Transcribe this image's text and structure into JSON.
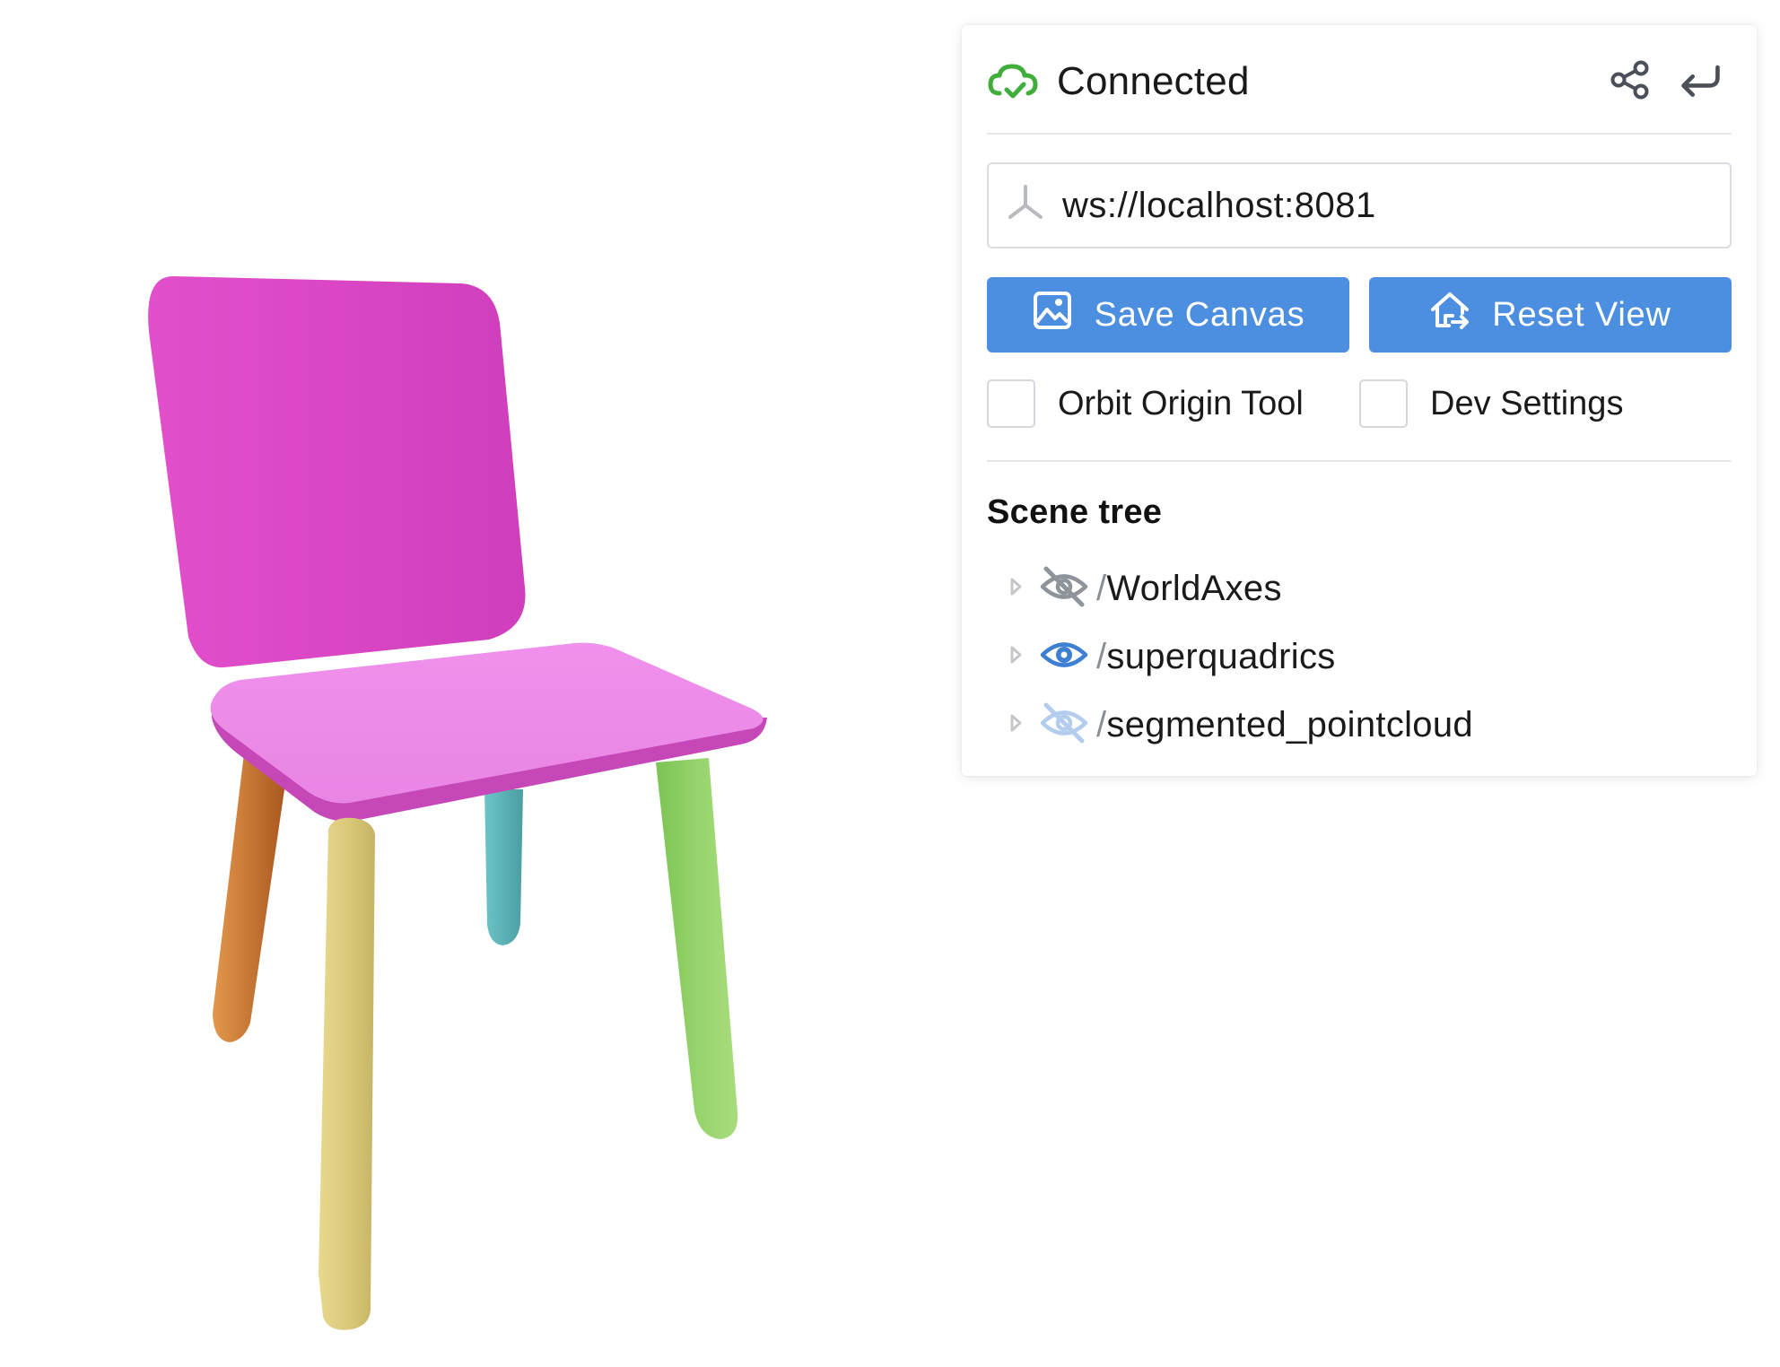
{
  "panel": {
    "status": {
      "icon": "cloud-check-icon",
      "text": "Connected",
      "color": "#3fae3a"
    },
    "header_actions": [
      {
        "name": "share-icon"
      },
      {
        "name": "return-arrow-icon"
      }
    ],
    "server_url": {
      "icon": "server-icon",
      "value": "ws://localhost:8081"
    },
    "buttons": {
      "save_canvas": {
        "label": "Save Canvas",
        "icon": "photo-icon"
      },
      "reset_view": {
        "label": "Reset View",
        "icon": "home-move-icon"
      }
    },
    "checkboxes": {
      "orbit_origin_tool": {
        "label": "Orbit Origin Tool",
        "checked": false
      },
      "dev_settings": {
        "label": "Dev Settings",
        "checked": false
      }
    },
    "scene_tree": {
      "title": "Scene tree",
      "nodes": [
        {
          "slash": "/",
          "name": "WorldAxes",
          "visibility": "hidden-gray"
        },
        {
          "slash": "/",
          "name": "superquadrics",
          "visibility": "visible"
        },
        {
          "slash": "/",
          "name": "segmented_pointcloud",
          "visibility": "hidden-light"
        }
      ]
    }
  },
  "colors": {
    "accent": "#4c8fe0",
    "status_ok": "#3fae3a",
    "chair_back": "#d946c3",
    "chair_seat_top": "#ee8bea",
    "leg_front_left": "#d9c878",
    "leg_back_left": "#c9702d",
    "leg_back_right": "#5cb3b6",
    "leg_front_right": "#8fd166"
  }
}
